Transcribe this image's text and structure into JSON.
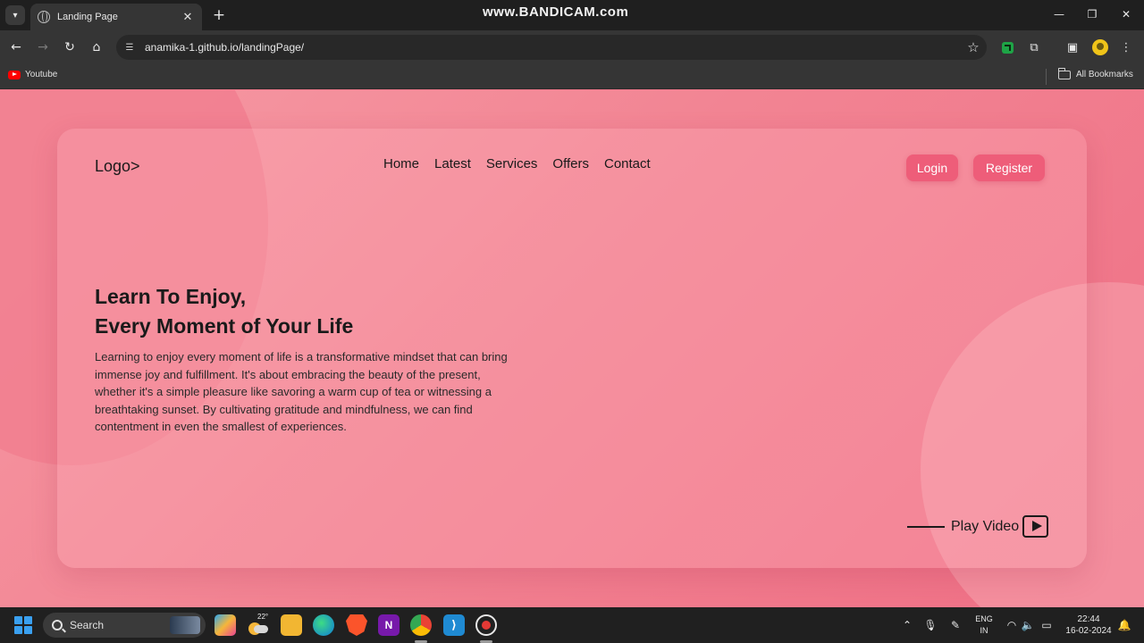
{
  "browser": {
    "tab_title": "Landing Page",
    "url": "anamika-1.github.io/landingPage/",
    "watermark": "www.BANDICAM.com",
    "bookmarks": [
      {
        "label": "Youtube",
        "icon": "youtube-icon"
      }
    ],
    "all_bookmarks_label": "All Bookmarks"
  },
  "page": {
    "logo": "Logo>",
    "nav": [
      "Home",
      "Latest",
      "Services",
      "Offers",
      "Contact"
    ],
    "buttons": {
      "login": "Login",
      "register": "Register"
    },
    "hero": {
      "title_line1": "Learn To Enjoy,",
      "title_line2": "Every Moment of Your Life",
      "body": "Learning to enjoy every moment of life is a transformative mindset that can bring immense joy and fulfillment. It's about embracing the beauty of the present, whether it's a simple pleasure like savoring a warm cup of tea or witnessing a breathtaking sunset. By cultivating gratitude and mindfulness, we can find contentment in even the smallest of experiences."
    },
    "play_video": "Play Video",
    "colors": {
      "accent": "#ee5d79",
      "background": "#f28493",
      "text": "#1a1a1a"
    }
  },
  "taskbar": {
    "search_label": "Search",
    "weather_temp": "22°",
    "language_line1": "ENG",
    "language_line2": "IN",
    "time": "22:44",
    "date": "16-02-2024"
  }
}
